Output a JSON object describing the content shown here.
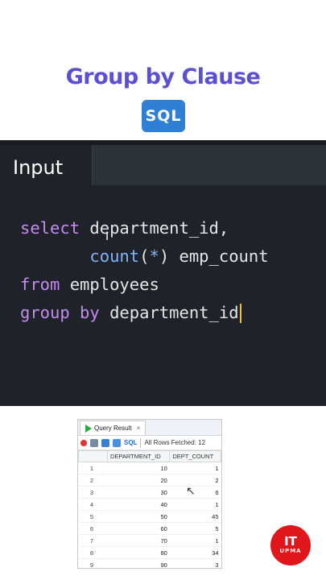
{
  "header": {
    "title": "Group by Clause",
    "badge": "SQL"
  },
  "editor": {
    "tab_label": "Input",
    "code": {
      "line1_kw": "select",
      "line1_rest": " department_id,",
      "line2_indent": "       ",
      "line2_fn": "count",
      "line2_open": "(",
      "line2_star": "*",
      "line2_close": ")",
      "line2_rest": " emp_count",
      "line3_kw": "from",
      "line3_rest": " employees",
      "line4_kw": "group by",
      "line4_rest": " department_id"
    }
  },
  "query_result": {
    "tab_label": "Query Result",
    "close_label": "×",
    "sql_label": "SQL",
    "fetched_label": "All Rows Fetched: 12",
    "columns": [
      "DEPARTMENT_ID",
      "DEPT_COUNT"
    ],
    "rows": [
      {
        "n": "1",
        "dept": "10",
        "count": "1"
      },
      {
        "n": "2",
        "dept": "20",
        "count": "2"
      },
      {
        "n": "3",
        "dept": "30",
        "count": "6"
      },
      {
        "n": "4",
        "dept": "40",
        "count": "1"
      },
      {
        "n": "5",
        "dept": "50",
        "count": "45"
      },
      {
        "n": "6",
        "dept": "60",
        "count": "5"
      },
      {
        "n": "7",
        "dept": "70",
        "count": "1"
      },
      {
        "n": "8",
        "dept": "80",
        "count": "34"
      },
      {
        "n": "9",
        "dept": "90",
        "count": "3"
      }
    ]
  },
  "logo": {
    "line1": "IT",
    "line2": "UPMA"
  },
  "colors": {
    "title": "#5b4fd6",
    "editor_bg": "#1f2329",
    "keyword": "#c48cf0",
    "function": "#7fb4ff",
    "badge": "#2f7fd4",
    "logo": "#e0161b"
  }
}
